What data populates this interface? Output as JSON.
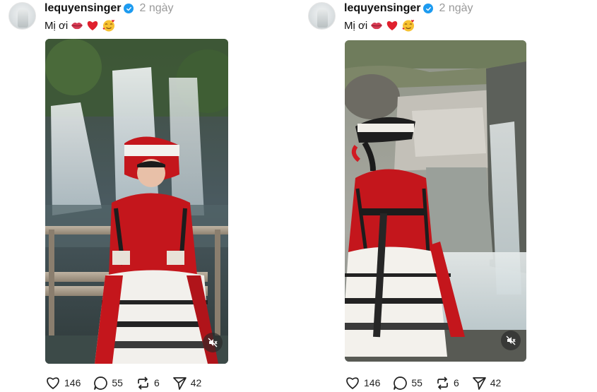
{
  "posts": [
    {
      "username": "lequyensinger",
      "timestamp": "2 ngày",
      "caption_text": "Mị ơi",
      "caption_emojis": [
        "lips",
        "red-heart",
        "smiling-face-with-hearts"
      ],
      "media": {
        "type": "video",
        "muted": true
      },
      "stats": {
        "likes": "146",
        "replies": "55",
        "reposts": "6",
        "shares": "42"
      }
    },
    {
      "username": "lequyensinger",
      "timestamp": "2 ngày",
      "caption_text": "Mị ơi",
      "caption_emojis": [
        "lips",
        "red-heart",
        "smiling-face-with-hearts"
      ],
      "media": {
        "type": "video",
        "muted": true
      },
      "stats": {
        "likes": "146",
        "replies": "55",
        "reposts": "6",
        "shares": "42"
      }
    }
  ],
  "colors": {
    "verified": "#1d9bf0",
    "timestamp": "#9a9a9a",
    "costume_red": "#c4161c"
  },
  "icons": [
    "verified-badge-icon",
    "lips-emoji-icon",
    "heart-emoji-icon",
    "smiling-hearts-emoji-icon",
    "mute-icon",
    "like-icon",
    "reply-icon",
    "repost-icon",
    "share-icon"
  ]
}
